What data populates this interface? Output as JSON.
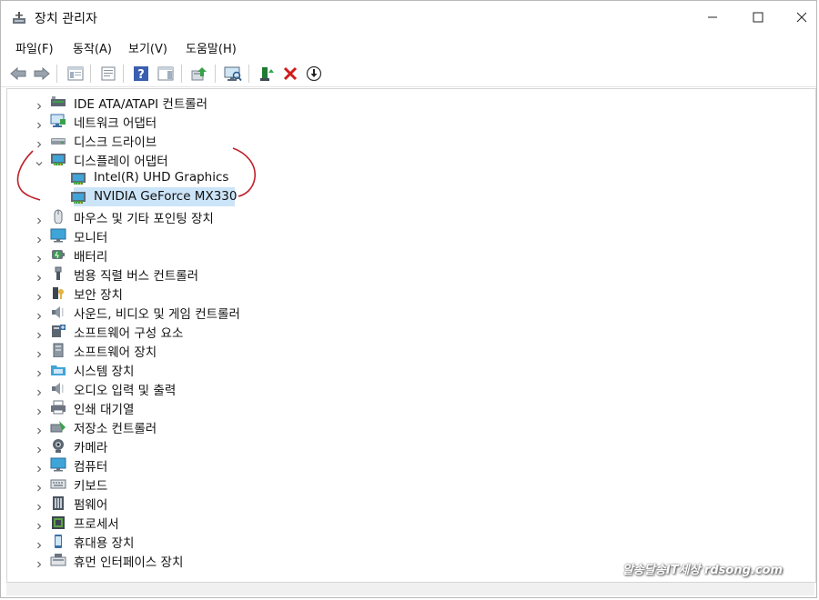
{
  "window": {
    "title": "장치 관리자"
  },
  "menu": [
    {
      "label": "파일(F)"
    },
    {
      "label": "동작(A)"
    },
    {
      "label": "보기(V)"
    },
    {
      "label": "도움말(H)"
    }
  ],
  "tree": {
    "items": [
      {
        "label": "IDE ATA/ATAPI 컨트롤러",
        "icon": "ide-controller-icon"
      },
      {
        "label": "네트워크 어댑터",
        "icon": "network-adapter-icon"
      },
      {
        "label": "디스크 드라이브",
        "icon": "disk-drive-icon"
      },
      {
        "label": "디스플레이 어댑터",
        "icon": "display-adapter-icon",
        "expanded": true,
        "children": [
          {
            "label": "Intel(R) UHD Graphics",
            "icon": "display-adapter-icon"
          },
          {
            "label": "NVIDIA GeForce MX330",
            "icon": "display-adapter-icon",
            "selected": true
          }
        ]
      },
      {
        "label": "마우스 및 기타 포인팅 장치",
        "icon": "mouse-icon"
      },
      {
        "label": "모니터",
        "icon": "monitor-icon"
      },
      {
        "label": "배터리",
        "icon": "battery-icon"
      },
      {
        "label": "범용 직렬 버스 컨트롤러",
        "icon": "usb-icon"
      },
      {
        "label": "보안 장치",
        "icon": "security-device-icon"
      },
      {
        "label": "사운드, 비디오 및 게임 컨트롤러",
        "icon": "speaker-icon"
      },
      {
        "label": "소프트웨어 구성 요소",
        "icon": "software-component-icon"
      },
      {
        "label": "소프트웨어 장치",
        "icon": "software-device-icon"
      },
      {
        "label": "시스템 장치",
        "icon": "system-folder-icon"
      },
      {
        "label": "오디오 입력 및 출력",
        "icon": "speaker-icon"
      },
      {
        "label": "인쇄 대기열",
        "icon": "printer-icon"
      },
      {
        "label": "저장소 컨트롤러",
        "icon": "storage-controller-icon"
      },
      {
        "label": "카메라",
        "icon": "camera-icon"
      },
      {
        "label": "컴퓨터",
        "icon": "computer-icon"
      },
      {
        "label": "키보드",
        "icon": "keyboard-icon"
      },
      {
        "label": "펌웨어",
        "icon": "firmware-icon"
      },
      {
        "label": "프로세서",
        "icon": "processor-icon"
      },
      {
        "label": "휴대용 장치",
        "icon": "portable-device-icon"
      },
      {
        "label": "휴먼 인터페이스 장치",
        "icon": "hid-icon"
      }
    ]
  },
  "watermark": "알송달송IT세상 rdsong.com",
  "colors": {
    "selection": "#cce4f7",
    "annotation": "#c0202a"
  }
}
